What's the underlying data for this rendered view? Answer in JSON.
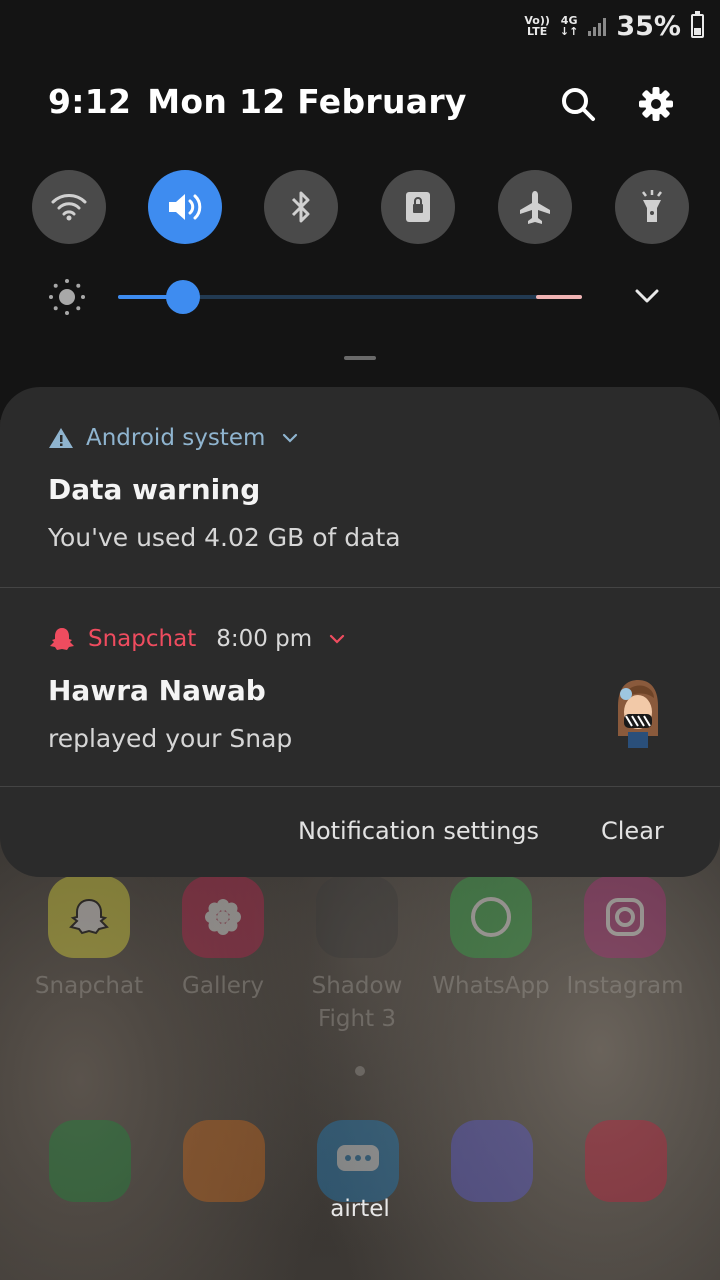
{
  "status_bar": {
    "volte": [
      "Vo))",
      "LTE"
    ],
    "network": [
      "4G",
      "↓↑"
    ],
    "battery_percent": "35%",
    "battery_level": 0.35
  },
  "header": {
    "time": "9:12",
    "date": "Mon 12 February",
    "search_icon": "search-icon",
    "settings_icon": "gear-icon"
  },
  "quick_settings": [
    {
      "name": "wifi",
      "icon": "wifi-icon",
      "active": false
    },
    {
      "name": "sound",
      "icon": "volume-icon",
      "active": true
    },
    {
      "name": "bluetooth",
      "icon": "bluetooth-icon",
      "active": false
    },
    {
      "name": "screen-lock",
      "icon": "lock-rotation-icon",
      "active": false
    },
    {
      "name": "airplane",
      "icon": "airplane-icon",
      "active": false
    },
    {
      "name": "flashlight",
      "icon": "flashlight-icon",
      "active": false
    }
  ],
  "brightness": {
    "icon": "brightness-icon",
    "level": 0.14,
    "accent": "#3e8cf0"
  },
  "notifications": [
    {
      "app": "Android system",
      "app_color": "#8fb4cf",
      "icon": "warning-icon",
      "title": "Data warning",
      "body": "You've used 4.02 GB of data"
    },
    {
      "app": "Snapchat",
      "app_color": "#ef4c5f",
      "icon": "snapchat-ghost-icon",
      "time": "8:00 pm",
      "title": "Hawra Nawab",
      "body": "replayed your Snap",
      "avatar": "bitmoji-avatar"
    }
  ],
  "footer": {
    "settings_label": "Notification settings",
    "clear_label": "Clear"
  },
  "home_screen": {
    "apps": [
      {
        "label": "Snapchat",
        "color": "#e8e23a"
      },
      {
        "label": "Gallery",
        "color": "#c21f4c"
      },
      {
        "label": "Shadow\nFight 3",
        "color": "#3a3a3a"
      },
      {
        "label": "WhatsApp",
        "color": "#2fb146"
      },
      {
        "label": "Instagram",
        "color": "#b22a7a"
      }
    ],
    "dock": [
      {
        "icon": "phone-icon",
        "color": "#1c8a3a"
      },
      {
        "icon": "contacts-icon",
        "color": "#d06a18"
      },
      {
        "icon": "messages-icon",
        "color": "#1f7fc0"
      },
      {
        "icon": "internet-icon",
        "color": "#5a5ad8"
      },
      {
        "icon": "camera-icon",
        "color": "#c81e3c"
      }
    ],
    "carrier": "airtel"
  }
}
